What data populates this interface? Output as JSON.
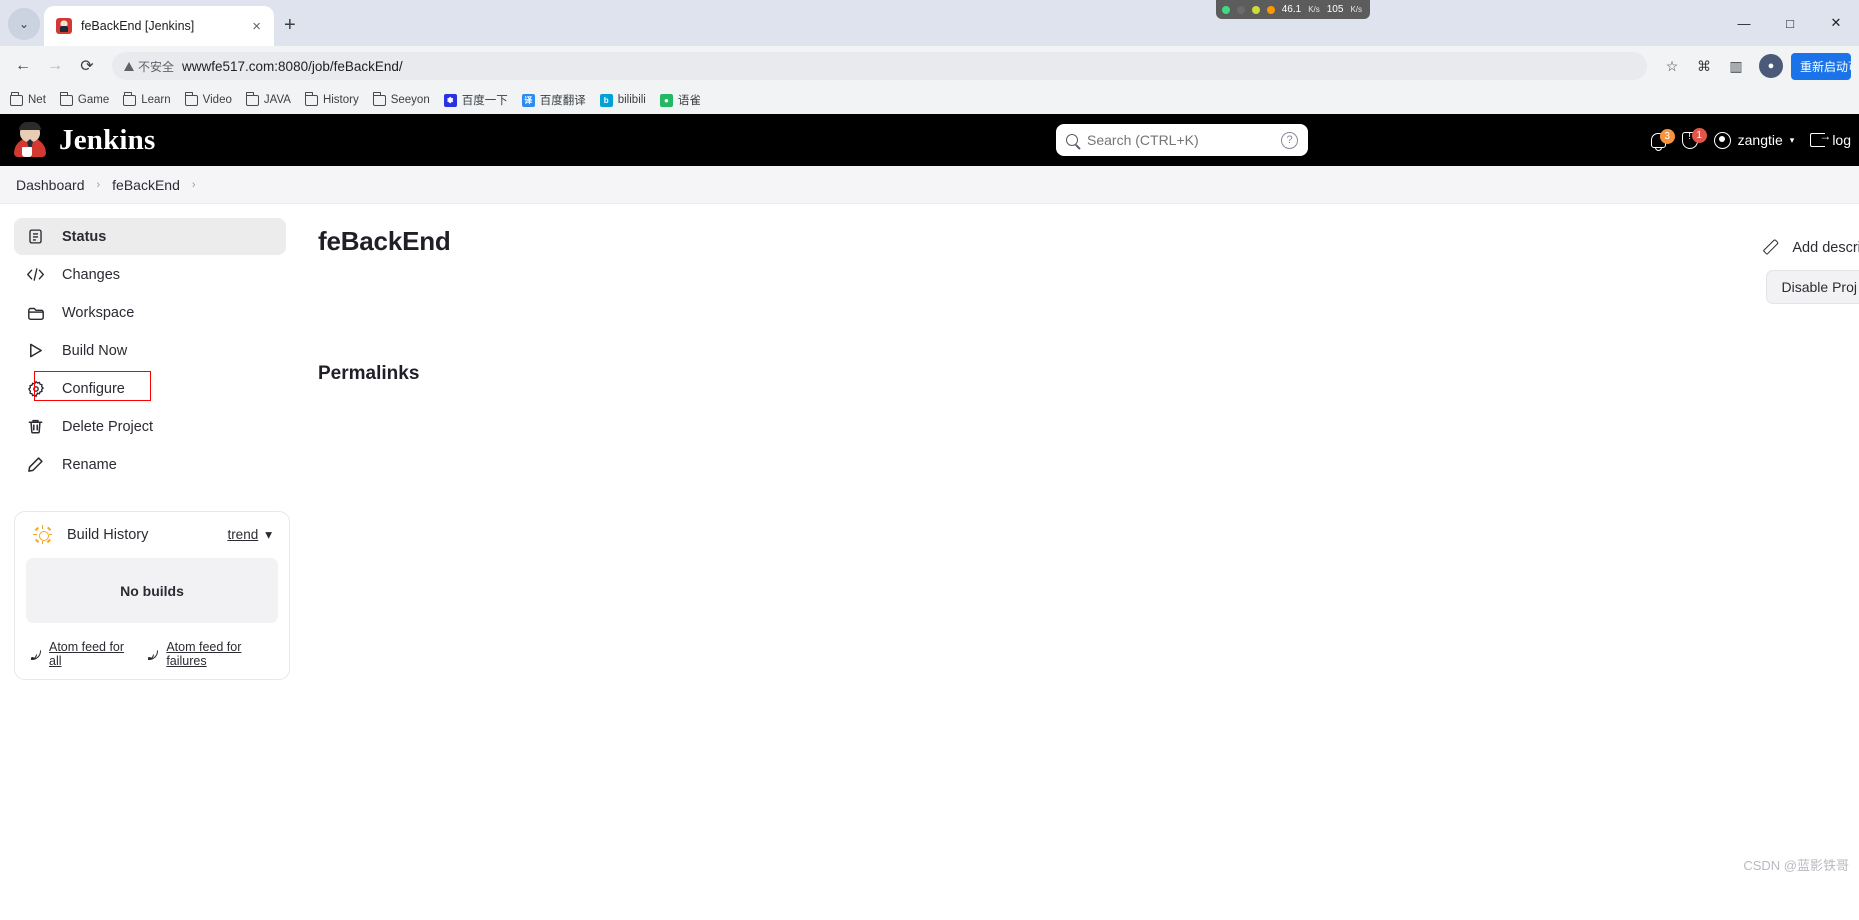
{
  "browser": {
    "tab": {
      "title": "feBackEnd [Jenkins]",
      "favicon": "jenkins-favicon",
      "close_label": "×"
    },
    "new_tab_label": "+",
    "tab_list_chevron": "⌄",
    "nav": {
      "back": "←",
      "forward": "→",
      "reload": "⟳"
    },
    "omnibox": {
      "security_label": "不安全",
      "url": "wwwfe517.com:8080/job/feBackEnd/",
      "star": "☆"
    },
    "toolbar_right": {
      "extensions": "⌘",
      "side_panel": "▥",
      "profile_initial": "●",
      "restore_label": "重新启动可"
    },
    "window_controls": {
      "minimize": "—",
      "maximize": "□",
      "close": "✕"
    },
    "netspeed": {
      "up_value": "46.1",
      "up_unit": "K/s",
      "down_value": "105",
      "down_unit": "K/s"
    },
    "bookmarks": [
      {
        "label": "Net",
        "icon": "folder-icon"
      },
      {
        "label": "Game",
        "icon": "folder-icon"
      },
      {
        "label": "Learn",
        "icon": "folder-icon"
      },
      {
        "label": "Video",
        "icon": "folder-icon"
      },
      {
        "label": "JAVA",
        "icon": "folder-icon"
      },
      {
        "label": "History",
        "icon": "folder-icon"
      },
      {
        "label": "Seeyon",
        "icon": "folder-icon"
      },
      {
        "label": "百度一下",
        "icon": "baidu-icon",
        "color": "#2932e1",
        "glyph": "❃"
      },
      {
        "label": "百度翻译",
        "icon": "baidu-translate-icon",
        "color": "#2d8cf0",
        "glyph": "译"
      },
      {
        "label": "bilibili",
        "icon": "bilibili-icon",
        "color": "#00a1d6",
        "glyph": "b"
      },
      {
        "label": "语雀",
        "icon": "yuque-icon",
        "color": "#25b864",
        "glyph": "●"
      }
    ]
  },
  "jenkins": {
    "brand": "Jenkins",
    "search": {
      "placeholder": "Search (CTRL+K)",
      "value": "",
      "help_glyph": "?"
    },
    "header_right": {
      "notifications_count": "3",
      "security_count": "1",
      "user_name": "zangtie",
      "logout_label": "log"
    },
    "breadcrumb": [
      {
        "label": "Dashboard"
      },
      {
        "label": "feBackEnd"
      }
    ],
    "breadcrumb_separator": "›",
    "sidebar": {
      "items": [
        {
          "label": "Status",
          "icon": "document-icon",
          "active": true
        },
        {
          "label": "Changes",
          "icon": "code-icon",
          "active": false
        },
        {
          "label": "Workspace",
          "icon": "folder-icon",
          "active": false
        },
        {
          "label": "Build Now",
          "icon": "play-icon",
          "active": false
        },
        {
          "label": "Configure",
          "icon": "gear-icon",
          "active": false
        },
        {
          "label": "Delete Project",
          "icon": "trash-icon",
          "active": false
        },
        {
          "label": "Rename",
          "icon": "pencil-icon",
          "active": false
        }
      ],
      "build_history": {
        "title": "Build History",
        "trend_label": "trend",
        "trend_caret": "⌄",
        "empty_label": "No builds",
        "feeds": [
          {
            "label": "Atom feed for all"
          },
          {
            "label": "Atom feed for failures"
          }
        ]
      }
    },
    "main": {
      "job_title": "feBackEnd",
      "permalinks_title": "Permalinks",
      "add_description_label": "Add descript",
      "disable_project_label": "Disable Proj"
    },
    "accent_colors": {
      "header_bg": "#000000",
      "notification_badge": "#fb923c",
      "security_badge": "#e2564a",
      "annotation_box": "#ff0000",
      "sun_icon": "#f5a623"
    }
  },
  "watermark": {
    "text": "CSDN @蓝影铁哥"
  }
}
